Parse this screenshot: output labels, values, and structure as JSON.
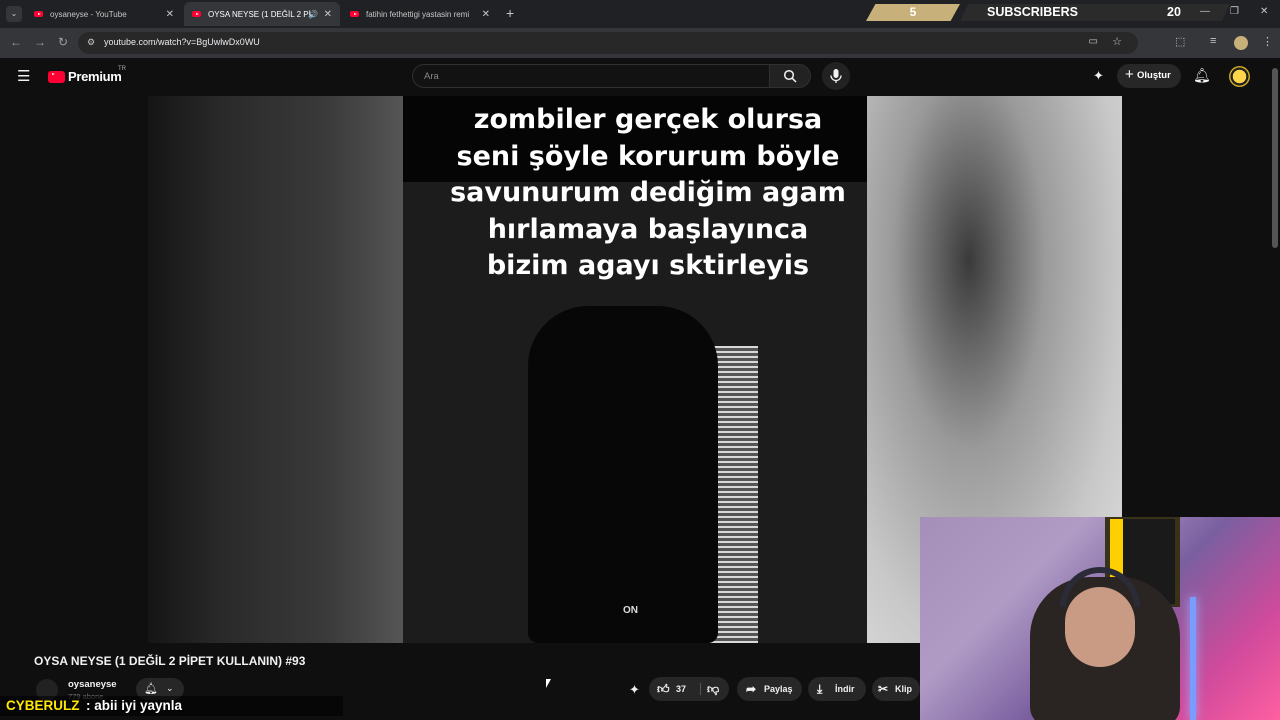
{
  "browser": {
    "tabs": [
      {
        "label": "oysaneyse - YouTube",
        "active": false
      },
      {
        "label": "OYSA NEYSE (1 DEĞİL 2 Pİ",
        "active": true
      },
      {
        "label": "fatihin fethettigi yastasin remi",
        "active": false
      }
    ],
    "url": "youtube.com/watch?v=BgUwlwDx0WU"
  },
  "stream_overlay": {
    "current": "5",
    "label": "SUBSCRIBERS",
    "goal": "20",
    "chat_user": "CYBERULZ",
    "chat_message": ": abii iyi yaynla"
  },
  "youtube": {
    "logo_text": "Premium",
    "region": "TR",
    "search_placeholder": "Ara",
    "create_label": "Oluştur"
  },
  "video": {
    "caption_lines": [
      "zombiler gerçek olursa",
      "seni şöyle korurum böyle",
      "savunurum dediğim agam",
      "hırlamaya başlayınca",
      "bizim agayı sktirleyis"
    ],
    "watermark": "ON",
    "title": "OYSA NEYSE (1 DEĞİL 2 PİPET KULLANIN) #93",
    "channel": "oysaneyse",
    "subscribers": "779 abone"
  },
  "actions": {
    "likes": "37",
    "share": "Paylaş",
    "download": "İndir",
    "clip": "Klip"
  },
  "colors": {
    "youtube_red": "#ff0033",
    "chat_user": "#ffe800",
    "goal_gold": "#c8b07a"
  }
}
